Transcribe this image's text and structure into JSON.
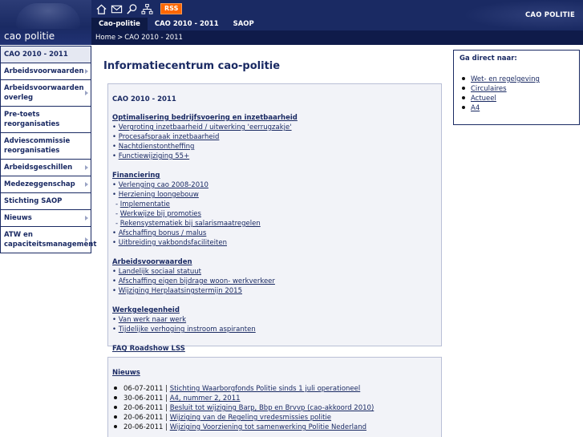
{
  "header": {
    "logo_text": "cao politie",
    "brand_text": "CAO POLITIE",
    "rss_label": "RSS",
    "tool_icons": [
      "home-icon",
      "mail-icon",
      "search-icon",
      "sitemap-icon"
    ],
    "tabs": [
      {
        "label": "Cao-politie",
        "active": true
      },
      {
        "label": "CAO 2010 - 2011",
        "active": false
      },
      {
        "label": "SAOP",
        "active": false
      }
    ],
    "breadcrumb": {
      "home": "Home",
      "separator": ">",
      "current": "CAO 2010 - 2011"
    }
  },
  "sidebar": {
    "items": [
      {
        "label": "CAO 2010 - 2011",
        "active": true,
        "arrow": false
      },
      {
        "label": "Arbeidsvoorwaarden",
        "arrow": true
      },
      {
        "label": "Arbeidsvoorwaarden overleg",
        "arrow": true
      },
      {
        "label": "Pre-toets reorganisaties",
        "arrow": false
      },
      {
        "label": "Adviescommissie reorganisaties",
        "arrow": false
      },
      {
        "label": "Arbeidsgeschillen",
        "arrow": true
      },
      {
        "label": "Medezeggenschap",
        "arrow": true
      },
      {
        "label": "Stichting SAOP",
        "arrow": false
      },
      {
        "label": "Nieuws",
        "arrow": true
      },
      {
        "label": "ATW en capaciteitsmanagement",
        "arrow": true
      }
    ]
  },
  "main": {
    "title": "Informatiecentrum cao-politie",
    "cao_panel": {
      "heading": "CAO 2010 - 2011",
      "groups": [
        {
          "title": "Optimalisering bedrijfsvoering en inzetbaarheid",
          "links": [
            {
              "prefix": "• ",
              "text": "Vergroting inzetbaarheid / uitwerking 'eerrugzakje'"
            },
            {
              "prefix": "• ",
              "text": "Procesafspraak inzetbaarheid"
            },
            {
              "prefix": "• ",
              "text": "Nachtdienstontheffing"
            },
            {
              "prefix": "• ",
              "text": "Functiewijziging 55+"
            }
          ]
        },
        {
          "title": "Financiering",
          "links": [
            {
              "prefix": "• ",
              "text": "Verlenging cao 2008-2010"
            },
            {
              "prefix": "• ",
              "text": "Herziening loongebouw"
            },
            {
              "prefix": " - ",
              "text": "Implementatie",
              "sub": true
            },
            {
              "prefix": " - ",
              "text": "Werkwijze bij promoties",
              "sub": true
            },
            {
              "prefix": " - ",
              "text": "Rekensystematiek bij salarismaatregelen",
              "sub": true
            },
            {
              "prefix": "• ",
              "text": "Afschaffing bonus / malus"
            },
            {
              "prefix": "• ",
              "text": "Uitbreiding vakbondsfaciliteiten"
            }
          ]
        },
        {
          "title": "Arbeidsvoorwaarden",
          "links": [
            {
              "prefix": "• ",
              "text": "Landelijk sociaal statuut"
            },
            {
              "prefix": "• ",
              "text": "Afschaffing eigen bijdrage woon- werkverkeer"
            },
            {
              "prefix": "• ",
              "text": "Wijziging Herplaatsingstermijn 2015"
            }
          ]
        },
        {
          "title": "Werkgelegenheid",
          "links": [
            {
              "prefix": "• ",
              "text": "Van werk naar werk"
            },
            {
              "prefix": "• ",
              "text": "Tijdelijke verhoging instroom aspiranten"
            }
          ]
        },
        {
          "title": "FAQ Roadshow LSS",
          "links": []
        }
      ]
    },
    "news_panel": {
      "heading": "Nieuws",
      "items": [
        {
          "date": "06-07-2011",
          "text": "Stichting Waarborgfonds Politie sinds 1 juli operationeel"
        },
        {
          "date": "30-06-2011",
          "text": "A4, nummer 2, 2011"
        },
        {
          "date": "20-06-2011",
          "text": "Besluit tot wijziging Barp, Bbp en Brvvp (cao-akkoord 2010)"
        },
        {
          "date": "20-06-2011",
          "text": "Wijziging van de Regeling vredesmissies politie"
        },
        {
          "date": "20-06-2011",
          "text": "Wijziging Voorziening tot samenwerking Politie Nederland"
        }
      ]
    }
  },
  "rightbox": {
    "heading": "Ga direct naar:",
    "links": [
      "Wet- en regelgeving",
      "Circulaires",
      "Actueel",
      "A4"
    ]
  }
}
